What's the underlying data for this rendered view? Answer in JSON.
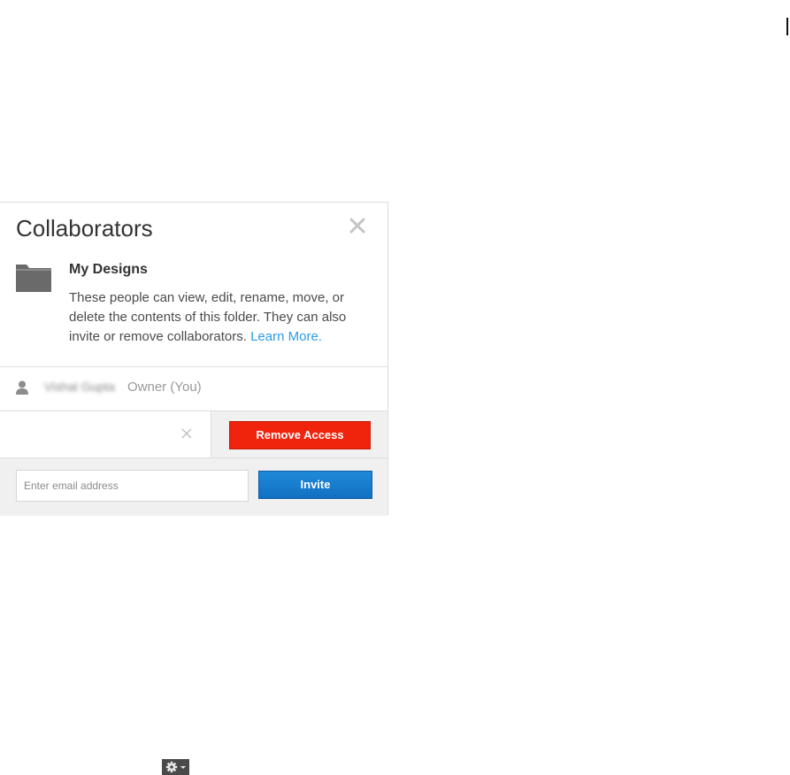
{
  "dialog": {
    "title": "Collaborators",
    "close_icon": "close-icon",
    "folder": {
      "icon": "folder-icon",
      "name": "My Designs",
      "description": "These people can view, edit, rename, move, or delete the contents of this folder. They can also invite or remove collaborators.",
      "learn_more_label": "Learn More."
    },
    "owner": {
      "icon": "person-icon",
      "name": "Vishal Gupta",
      "role": "Owner (You)"
    },
    "collaborator_row": {
      "remove_icon": "close-icon",
      "remove_access_label": "Remove Access"
    },
    "invite": {
      "email_placeholder": "Enter email address",
      "email_value": "",
      "invite_label": "Invite"
    }
  },
  "footer": {
    "gear_menu_icon": "gear-icon"
  },
  "colors": {
    "remove_button": "#f0230d",
    "invite_button": "#1473c7",
    "link": "#2c9ce6",
    "panel_gray": "#f0f0f0"
  }
}
